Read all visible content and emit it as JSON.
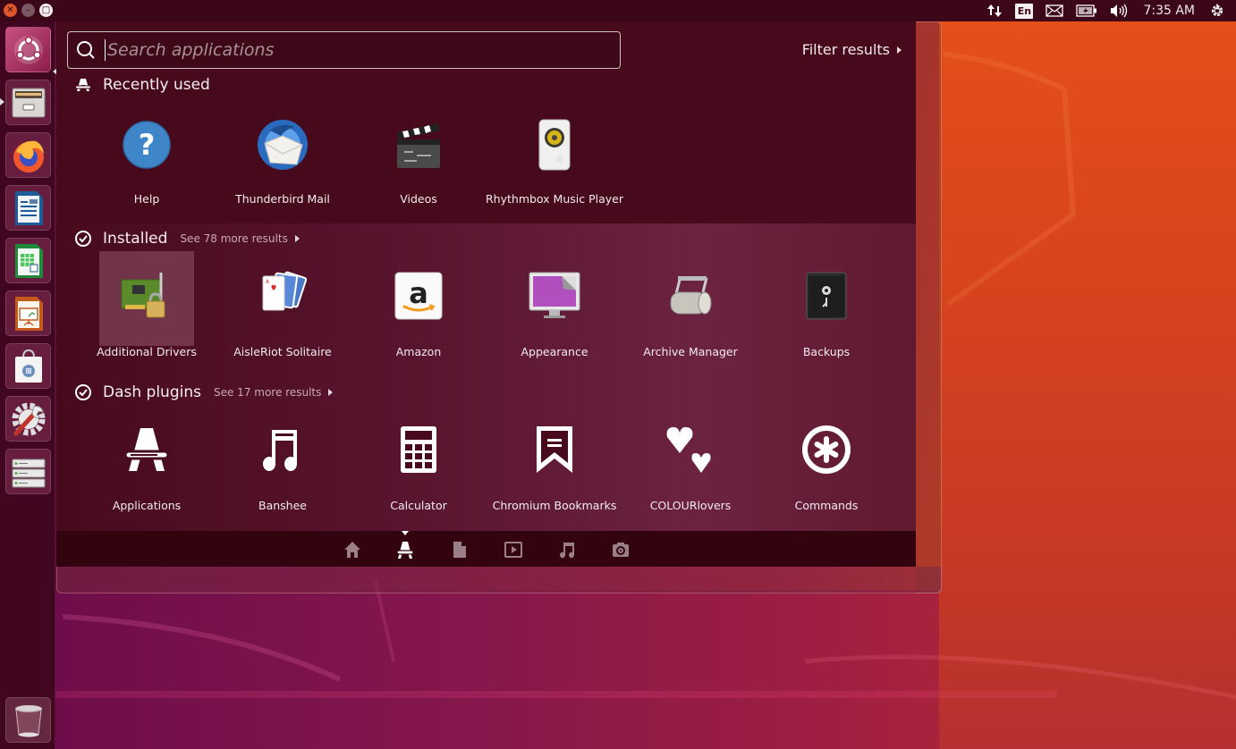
{
  "window_controls": {
    "close": "close",
    "minimize": "minimize",
    "maximize": "maximize"
  },
  "top_panel": {
    "indicators": {
      "network": "network-updown-icon",
      "keyboard_layout": "En",
      "messaging": "mail-icon",
      "battery": "battery-charging-icon",
      "sound": "volume-icon",
      "clock": "7:35 AM",
      "session": "power-gear-icon"
    }
  },
  "launcher": {
    "items": [
      {
        "name": "Dash home",
        "icon": "ubuntu-logo-icon"
      },
      {
        "name": "Files",
        "icon": "file-cabinet-icon"
      },
      {
        "name": "Firefox Web Browser",
        "icon": "firefox-icon"
      },
      {
        "name": "LibreOffice Writer",
        "icon": "writer-icon"
      },
      {
        "name": "LibreOffice Calc",
        "icon": "calc-icon"
      },
      {
        "name": "LibreOffice Impress",
        "icon": "impress-icon"
      },
      {
        "name": "Ubuntu Software",
        "icon": "software-bag-icon"
      },
      {
        "name": "System Settings",
        "icon": "settings-wrench-icon"
      },
      {
        "name": "Software Updater",
        "icon": "servers-icon"
      }
    ],
    "trash": {
      "name": "Trash",
      "icon": "trash-icon"
    }
  },
  "dash": {
    "search": {
      "placeholder": "Search applications",
      "value": ""
    },
    "filter_results": "Filter results",
    "sections": {
      "recent": {
        "title": "Recently used",
        "items": [
          {
            "label": "Help"
          },
          {
            "label": "Thunderbird Mail"
          },
          {
            "label": "Videos"
          },
          {
            "label": "Rhythmbox Music Player"
          }
        ]
      },
      "installed": {
        "title": "Installed",
        "see_more": "See 78 more results",
        "items": [
          {
            "label": "Additional Drivers",
            "selected": true
          },
          {
            "label": "AisleRiot Solitaire"
          },
          {
            "label": "Amazon"
          },
          {
            "label": "Appearance"
          },
          {
            "label": "Archive Manager"
          },
          {
            "label": "Backups"
          }
        ]
      },
      "plugins": {
        "title": "Dash plugins",
        "see_more": "See 17 more results",
        "items": [
          {
            "label": "Applications"
          },
          {
            "label": "Banshee"
          },
          {
            "label": "Calculator"
          },
          {
            "label": "Chromium Bookmarks"
          },
          {
            "label": "COLOURlovers"
          },
          {
            "label": "Commands"
          }
        ]
      }
    },
    "lenses": [
      {
        "name": "Home",
        "icon": "home-icon"
      },
      {
        "name": "Applications",
        "icon": "applications-icon",
        "active": true
      },
      {
        "name": "Files",
        "icon": "file-icon"
      },
      {
        "name": "Videos",
        "icon": "video-icon"
      },
      {
        "name": "Music",
        "icon": "music-icon"
      },
      {
        "name": "Photos",
        "icon": "camera-icon"
      }
    ]
  },
  "colors": {
    "panel": "#3c0719",
    "dash_bg": "#470a1d",
    "accent_orange": "#e9541b"
  }
}
